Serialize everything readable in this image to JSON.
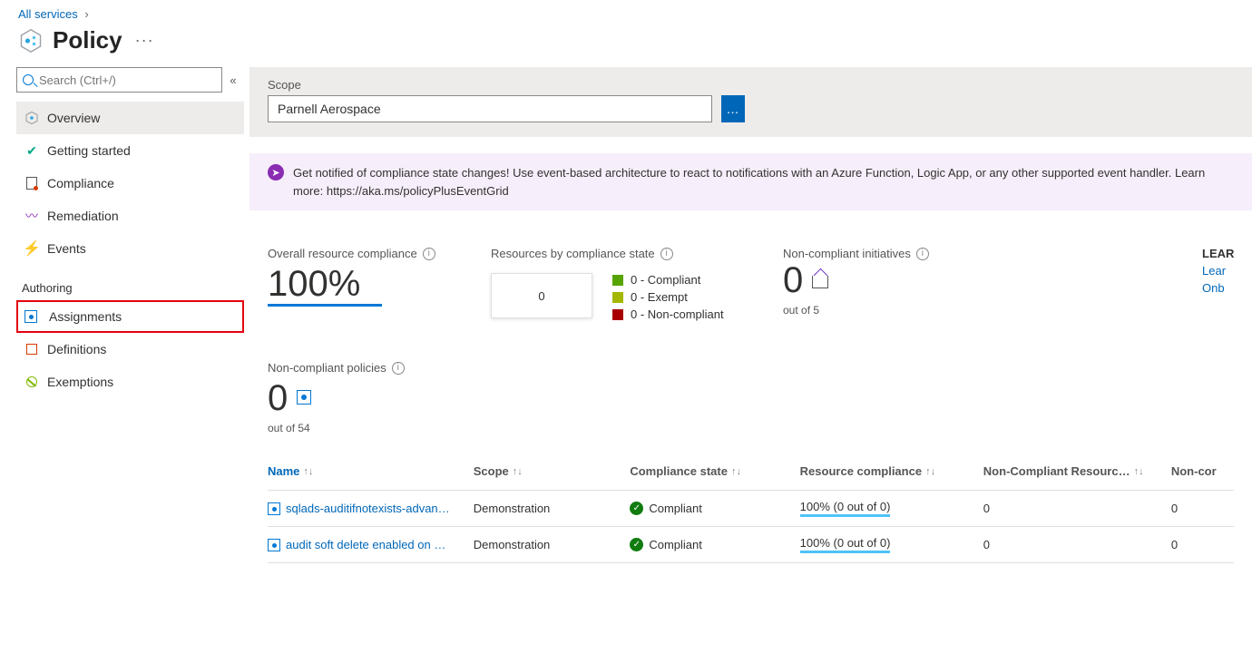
{
  "breadcrumb": {
    "all_services": "All services"
  },
  "page_title": "Policy",
  "sidebar": {
    "search_placeholder": "Search (Ctrl+/)",
    "items": [
      {
        "label": "Overview"
      },
      {
        "label": "Getting started"
      },
      {
        "label": "Compliance"
      },
      {
        "label": "Remediation"
      },
      {
        "label": "Events"
      }
    ],
    "authoring_label": "Authoring",
    "authoring_items": [
      {
        "label": "Assignments"
      },
      {
        "label": "Definitions"
      },
      {
        "label": "Exemptions"
      }
    ]
  },
  "scope": {
    "label": "Scope",
    "value": "Parnell Aerospace"
  },
  "banner": {
    "text": "Get notified of compliance state changes! Use event-based architecture to react to notifications with an Azure Function, Logic App, or any other supported event handler. Learn more: https://aka.ms/policyPlusEventGrid"
  },
  "kpi": {
    "overall_label": "Overall resource compliance",
    "overall_value": "100%",
    "bystate_label": "Resources by compliance state",
    "donut_center": "0",
    "legend": {
      "compliant": "0 - Compliant",
      "exempt": "0 - Exempt",
      "noncompliant": "0 - Non-compliant"
    },
    "initiatives_label": "Non-compliant initiatives",
    "initiatives_value": "0",
    "initiatives_sub": "out of 5",
    "policies_label": "Non-compliant policies",
    "policies_value": "0",
    "policies_sub": "out of 54"
  },
  "learn": {
    "heading": "LEARN",
    "link1": "Lear",
    "link2": "Onb"
  },
  "table": {
    "headers": {
      "name": "Name",
      "scope": "Scope",
      "state": "Compliance state",
      "rc": "Resource compliance",
      "nr": "Non-Compliant Resourc…",
      "nc": "Non-cor"
    },
    "rows": [
      {
        "name": "sqlads-auditifnotexists-advan…",
        "scope": "Demonstration",
        "state": "Compliant",
        "rc": "100% (0 out of 0)",
        "nr": "0",
        "nc": "0"
      },
      {
        "name": "audit soft delete enabled on …",
        "scope": "Demonstration",
        "state": "Compliant",
        "rc": "100% (0 out of 0)",
        "nr": "0",
        "nc": "0"
      }
    ]
  }
}
